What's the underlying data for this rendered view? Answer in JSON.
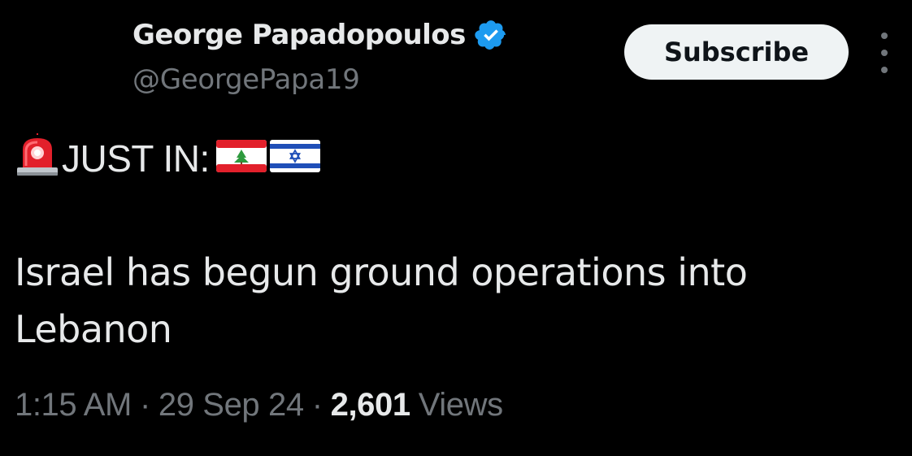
{
  "author": {
    "display_name": "George Papadopoulos",
    "handle": "@GeorgePapa19",
    "verified": true,
    "verified_icon": "verified-badge-icon",
    "verified_color": "#1d9bf0"
  },
  "header": {
    "subscribe_label": "Subscribe",
    "more_icon": "more-vertical-icon"
  },
  "tweet": {
    "prefix_icon": "police-light-emoji",
    "lead": "JUST IN:",
    "flag_1": "lebanon-flag-emoji",
    "flag_2": "israel-flag-emoji",
    "body": "Israel has begun ground operations into Lebanon"
  },
  "meta": {
    "time": "1:15 AM",
    "separator": "·",
    "date": "29 Sep 24",
    "views_count": "2,601",
    "views_label": "Views"
  },
  "colors": {
    "background": "#000000",
    "primary_text": "#e7e9ea",
    "secondary_text": "#71767b",
    "button_bg": "#eff3f4",
    "button_text": "#0f1419"
  }
}
